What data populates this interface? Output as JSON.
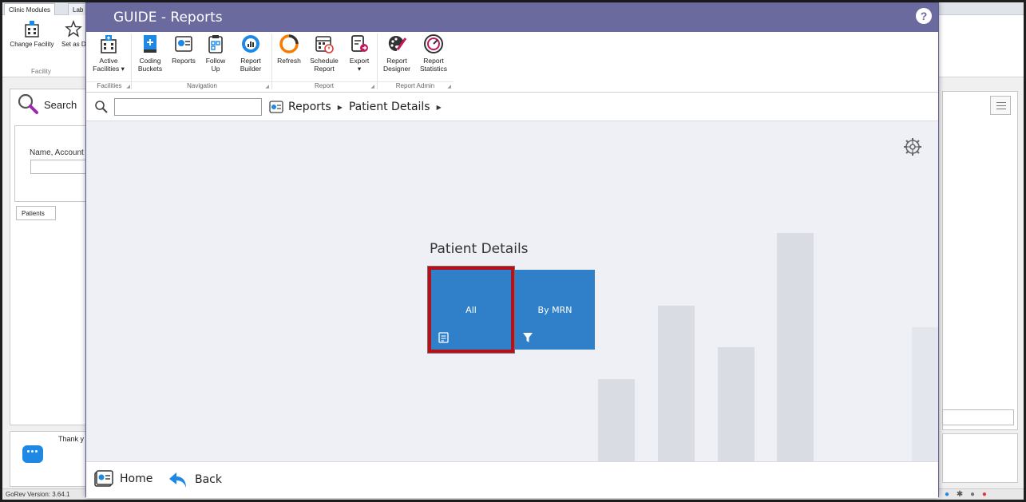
{
  "background_app": {
    "tabs": [
      "Clinic Modules",
      "Lab"
    ],
    "ribbon": {
      "change_facility": "Change Facility",
      "set_as_default": "Set as Default",
      "group_facility": "Facility"
    },
    "search_label": "Search",
    "name_label": "Name, Account",
    "patients_tab": "Patients",
    "chat_text": "Thank y",
    "version": "GoRev Version: 3.64.1"
  },
  "modal": {
    "title": "GUIDE - Reports",
    "help": "?",
    "ribbon": {
      "buttons": {
        "active_facilities": "Active Facilities ▾",
        "coding_buckets": "Coding Buckets",
        "reports": "Reports",
        "follow_up": "Follow Up",
        "report_builder": "Report Builder",
        "refresh": "Refresh",
        "schedule_report": "Schedule Report",
        "export": "Export",
        "export_arrow": "▾",
        "report_designer": "Report Designer",
        "report_statistics": "Report Statistics"
      },
      "groups": {
        "facilities": "Facilities",
        "navigation": "Navigation",
        "report": "Report",
        "report_admin": "Report Admin"
      }
    },
    "search": {
      "value": "",
      "placeholder": ""
    },
    "breadcrumb": [
      "Reports",
      "Patient Details"
    ],
    "section_title": "Patient Details",
    "tiles": [
      {
        "label": "All",
        "icon": "report-icon",
        "selected": true
      },
      {
        "label": "By MRN",
        "icon": "filter-icon",
        "selected": false
      }
    ],
    "footer": {
      "home": "Home",
      "back": "Back"
    },
    "colors": {
      "titlebar": "#6a6a9f",
      "tile": "#2f80c8",
      "highlight": "#b3121d"
    }
  }
}
